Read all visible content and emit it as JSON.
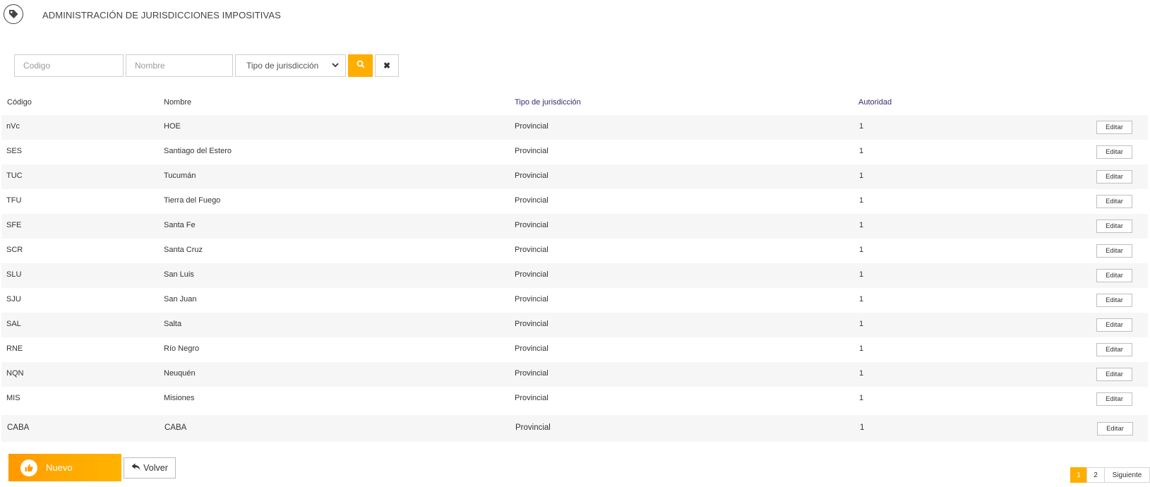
{
  "header": {
    "icon": "tag-icon",
    "title": "ADMINISTRACIÓN DE JURISDICCIONES IMPOSITIVAS"
  },
  "filters": {
    "code_placeholder": "Codigo",
    "name_placeholder": "Nombre",
    "type_select_value": "Tipo de jurisdicción",
    "search_icon": "search-icon",
    "clear_icon": "close-icon",
    "clear_label": "✖"
  },
  "table": {
    "columns": [
      "Código",
      "Nombre",
      "Tipo de jurisdicción",
      "Autoridad"
    ],
    "edit_label": "Editar",
    "rows": [
      [
        "nVc",
        "HOE",
        "Provincial",
        "1"
      ],
      [
        "SES",
        "Santiago del Estero",
        "Provincial",
        "1"
      ],
      [
        "TUC",
        "Tucumán",
        "Provincial",
        "1"
      ],
      [
        "TFU",
        "Tierra del Fuego",
        "Provincial",
        "1"
      ],
      [
        "SFE",
        "Santa Fe",
        "Provincial",
        "1"
      ],
      [
        "SCR",
        "Santa Cruz",
        "Provincial",
        "1"
      ],
      [
        "SLU",
        "San Luis",
        "Provincial",
        "1"
      ],
      [
        "SJU",
        "San Juan",
        "Provincial",
        "1"
      ],
      [
        "SAL",
        "Salta",
        "Provincial",
        "1"
      ],
      [
        "RNE",
        "Río Negro",
        "Provincial",
        "1"
      ],
      [
        "NQN",
        "Neuquén",
        "Provincial",
        "1"
      ],
      [
        "MIS",
        "Misiones",
        "Provincial",
        "1"
      ],
      [
        "CABA",
        "CABA",
        "Provincial",
        "1"
      ]
    ]
  },
  "footer": {
    "new_label": "Nuevo",
    "new_icon": "thumbs-up-icon",
    "back_label": "Volver",
    "back_icon": "reply-arrow-icon"
  },
  "pagination": {
    "pages": [
      "1",
      "2"
    ],
    "current": "1",
    "next_label": "Siguiente"
  },
  "colors": {
    "accent": "#ffae00",
    "header_accent_text": "#3c2a6b",
    "row_stripe": "#f6f6f6"
  }
}
